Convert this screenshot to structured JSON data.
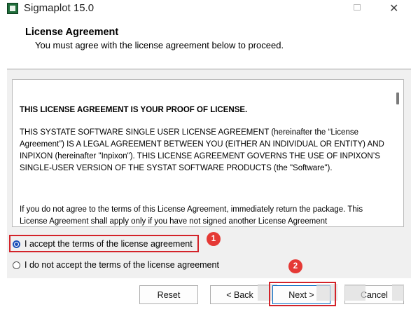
{
  "window": {
    "title": "Sigmaplot 15.0",
    "minimize_icon": "minimize-icon",
    "close_glyph": "✕"
  },
  "header": {
    "title": "License Agreement",
    "subtitle": "You must agree with the license agreement below to proceed."
  },
  "license": {
    "paragraphs": [
      "THIS LICENSE AGREEMENT IS YOUR PROOF OF LICENSE.",
      "THIS SYSTATE SOFTWARE SINGLE USER LICENSE AGREEMENT (hereinafter the “License Agreement”) IS A LEGAL AGREEMENT BETWEEN YOU (EITHER AN INDIVIDUAL OR ENTITY) AND INPIXON (hereinafter \"Inpixon\"). THIS LICENSE AGREEMENT GOVERNS THE USE OF INPIXON’S SINGLE-USER VERSION OF THE SYSTAT SOFTWARE PRODUCTS (the \"Software\").",
      "If you do not agree to the terms of this License Agreement, immediately return the package. This License Agreement shall apply only if you have not signed another License Agreement"
    ]
  },
  "options": {
    "accept_label": "I accept the terms of the license agreement",
    "decline_label": "I do not accept the terms of the license agreement",
    "selected": "accept"
  },
  "buttons": {
    "reset": "Reset",
    "back": "< Back",
    "next": "Next >",
    "cancel": "Cancel"
  },
  "annotations": {
    "step1": "1",
    "step2": "2",
    "highlight_color": "#d3232a",
    "badge_color": "#e53935"
  }
}
